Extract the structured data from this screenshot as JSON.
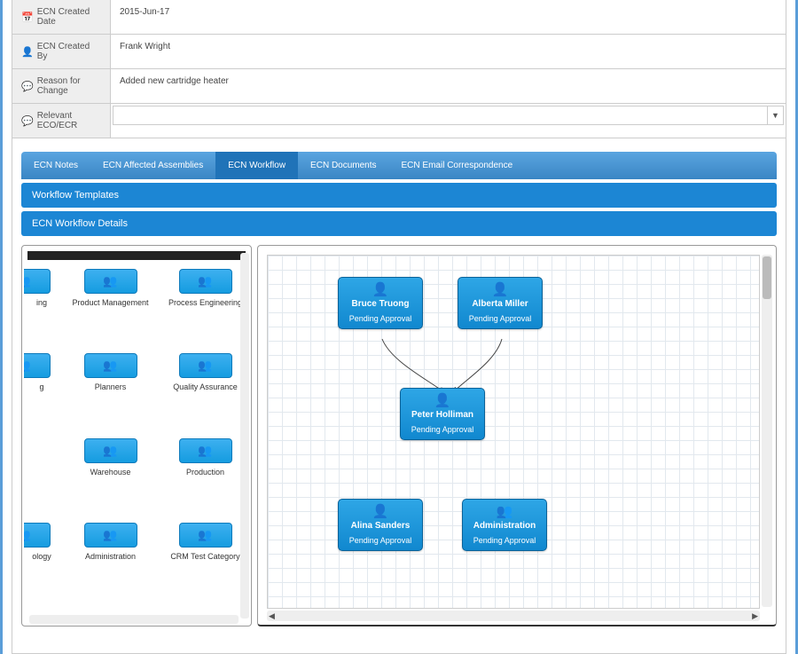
{
  "form": {
    "created_date_label": "ECN Created Date",
    "created_date_value": "2015-Jun-17",
    "created_by_label": "ECN Created By",
    "created_by_value": "Frank Wright",
    "reason_label": "Reason for Change",
    "reason_value": "Added new cartridge heater",
    "relevant_label": "Relevant ECO/ECR"
  },
  "tabs": {
    "notes": "ECN Notes",
    "assemblies": "ECN Affected Assemblies",
    "workflow": "ECN Workflow",
    "documents": "ECN Documents",
    "email": "ECN Email Correspondence"
  },
  "panels": {
    "templates": "Workflow Templates",
    "details": "ECN Workflow Details"
  },
  "palette": {
    "row1_partial": "ing",
    "product_mgmt": "Product Management",
    "process_eng": "Process Engineering",
    "row2_partial": "g",
    "planners": "Planners",
    "qa": "Quality Assurance",
    "warehouse": "Warehouse",
    "production": "Production",
    "row4_partial": "ology",
    "admin": "Administration",
    "crm": "CRM Test Category"
  },
  "nodes": {
    "bruce": {
      "name": "Bruce Truong",
      "status": "Pending Approval"
    },
    "alberta": {
      "name": "Alberta Miller",
      "status": "Pending Approval"
    },
    "peter": {
      "name": "Peter Holliman",
      "status": "Pending Approval"
    },
    "alina": {
      "name": "Alina Sanders",
      "status": "Pending Approval"
    },
    "admin": {
      "name": "Administration",
      "status": "Pending Approval"
    }
  }
}
